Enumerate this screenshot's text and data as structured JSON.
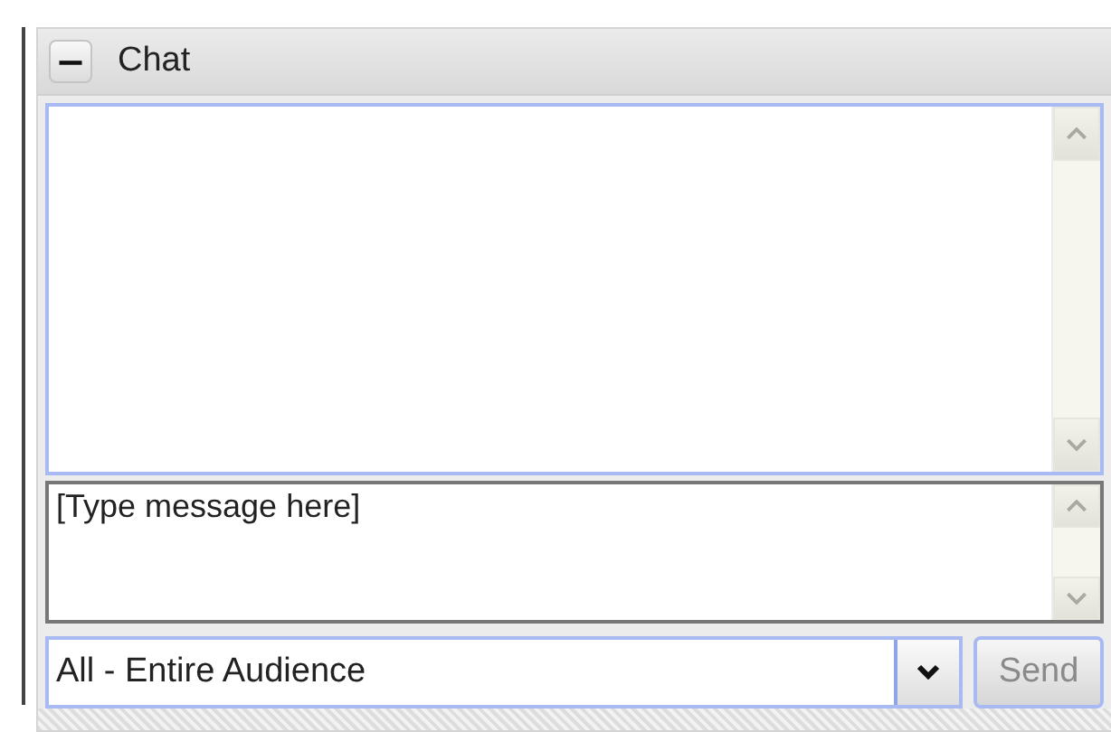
{
  "panel": {
    "collapse_symbol": "−",
    "title": "Chat",
    "expanded": true
  },
  "message_input": {
    "placeholder": "[Type message here]"
  },
  "recipient_select": {
    "value": "All - Entire Audience"
  },
  "send_button": {
    "label": "Send",
    "disabled": true
  }
}
